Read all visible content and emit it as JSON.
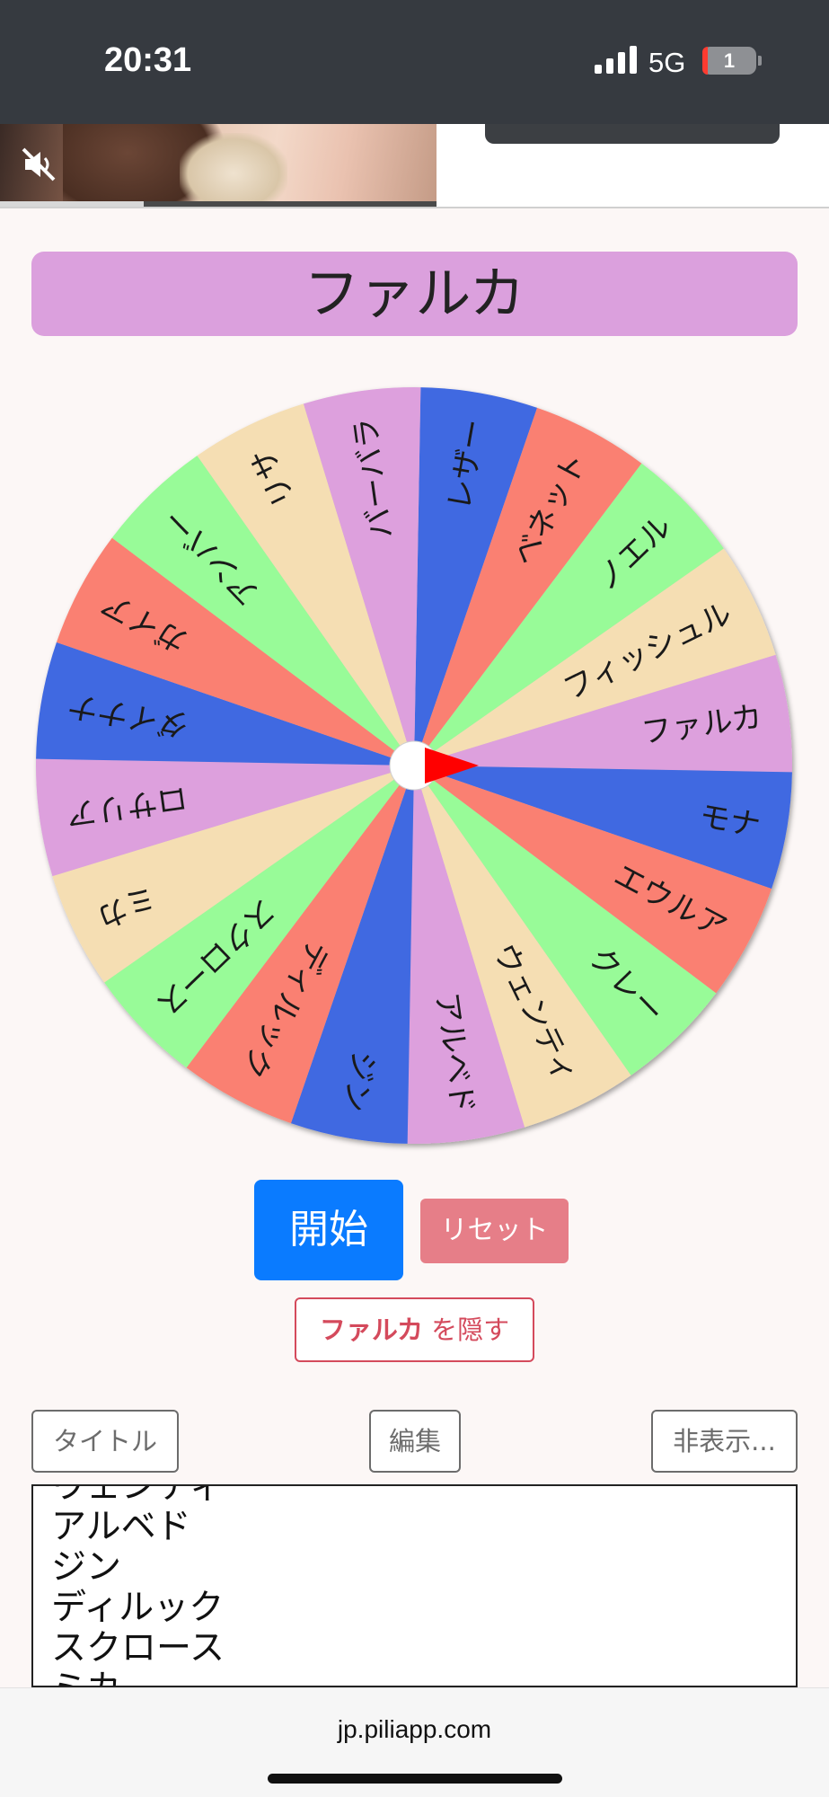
{
  "status_bar": {
    "time": "20:31",
    "network": "5G",
    "battery_level": "1",
    "signal_icon": "signal-bars-icon",
    "battery_icon": "battery-icon"
  },
  "ad": {
    "mute_icon": "speaker-muted-icon",
    "progress": 0.33
  },
  "header": {
    "title": "ファルカ"
  },
  "wheel": {
    "pointer_color": "#ff0000",
    "segments": [
      {
        "label": "レザー",
        "color": "#4169e1"
      },
      {
        "label": "ベネット",
        "color": "#fa8072"
      },
      {
        "label": "ノエル",
        "color": "#98fb98"
      },
      {
        "label": "フィッシュル",
        "color": "#f5deb3"
      },
      {
        "label": "ファルカ",
        "color": "#dda0dd"
      },
      {
        "label": "モナ",
        "color": "#4169e1"
      },
      {
        "label": "エウルア",
        "color": "#fa8072"
      },
      {
        "label": "クレー",
        "color": "#98fb98"
      },
      {
        "label": "ウェンティ",
        "color": "#f5deb3"
      },
      {
        "label": "アルベド",
        "color": "#dda0dd"
      },
      {
        "label": "ジン",
        "color": "#4169e1"
      },
      {
        "label": "ディルック",
        "color": "#fa8072"
      },
      {
        "label": "スクロース",
        "color": "#98fb98"
      },
      {
        "label": "ミカ",
        "color": "#f5deb3"
      },
      {
        "label": "ロサリア",
        "color": "#dda0dd"
      },
      {
        "label": "ダイナナ",
        "color": "#4169e1"
      },
      {
        "label": "ガイア",
        "color": "#fa8072"
      },
      {
        "label": "アンバー",
        "color": "#98fb98"
      },
      {
        "label": "リサ",
        "color": "#f5deb3"
      },
      {
        "label": "バーバラ",
        "color": "#dda0dd"
      }
    ]
  },
  "controls": {
    "start_label": "開始",
    "reset_label": "リセット",
    "hide_name": "ファルカ",
    "hide_suffix": " を隠す",
    "title_label": "タイトル",
    "edit_label": "編集",
    "hidden_label": "非表示..."
  },
  "entry_list": {
    "items": [
      "ウェンティ",
      "アルベド",
      "ジン",
      "ディルック",
      "スクロース",
      "ミカ"
    ]
  },
  "browser": {
    "url": "jp.piliapp.com"
  }
}
